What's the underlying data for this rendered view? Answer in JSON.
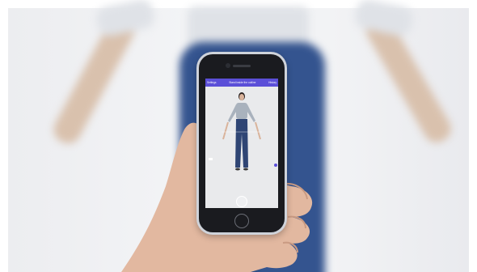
{
  "app": {
    "left_link": "Settings",
    "title": "Stand inside the outline",
    "right_link": "History"
  },
  "colors": {
    "accent": "#5b4fd8",
    "jeans": "#34548f",
    "backdrop": "#f2f3f5",
    "phone_frame": "#cfd3da"
  },
  "icons": {
    "capture": "shutter-circle-icon",
    "home": "home-button-icon"
  }
}
